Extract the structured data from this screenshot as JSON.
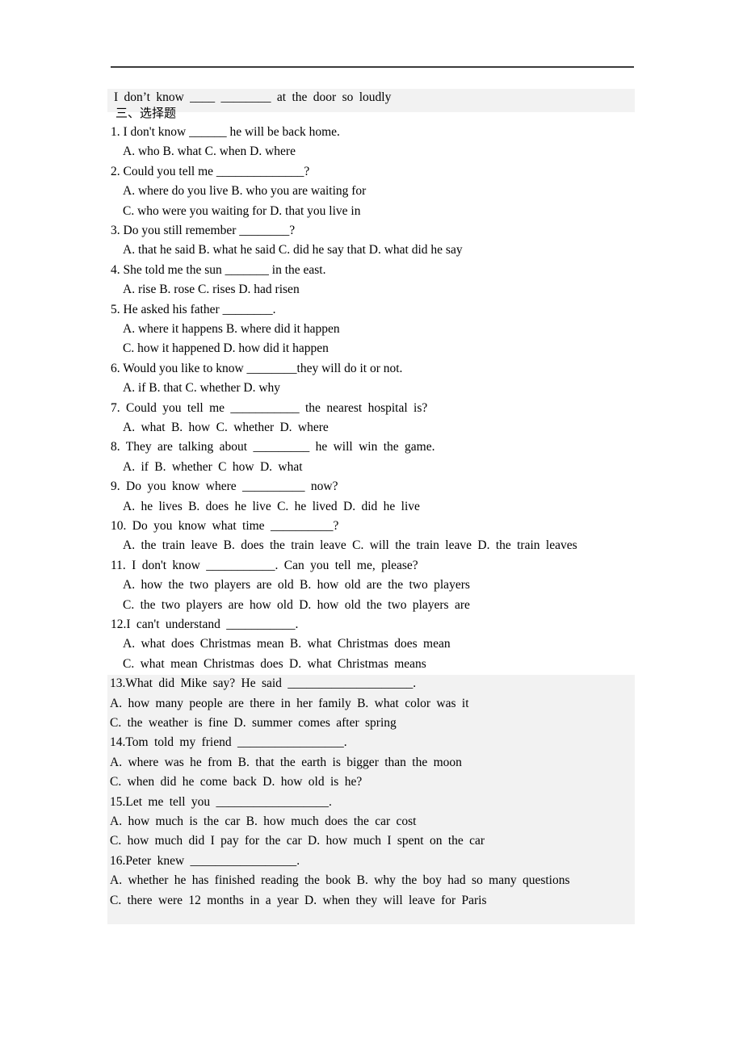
{
  "document": {
    "type": "worksheet",
    "section_heading": "三、选择题",
    "top_shaded_line": "I don’t know ____  ________  at the door so loudly",
    "questions": [
      {
        "number": "1.",
        "stem": "I don't know ______ he will be back home.",
        "option_lines": [
          "A. who    B. what    C. when    D. where"
        ],
        "indented": true,
        "spaced": false
      },
      {
        "number": "2.",
        "stem": "Could you tell me ______________?",
        "option_lines": [
          "A. where do you live            B. who you are waiting for",
          "C. who were you waiting for     D. that you live in"
        ],
        "indented": true,
        "spaced": false
      },
      {
        "number": "3.",
        "stem": "Do you still remember ________?",
        "option_lines": [
          "A. that he said    B. what he said    C. did he say that    D. what did he say"
        ],
        "indented": true,
        "spaced": false
      },
      {
        "number": "4.",
        "stem": "She told me the sun _______ in the east.",
        "option_lines": [
          "A. rise    B. rose    C. rises    D. had risen"
        ],
        "indented": true,
        "spaced": false
      },
      {
        "number": "5.",
        "stem": "He asked his father ________.",
        "option_lines": [
          "A. where it happens     B. where did it happen",
          "C. how it happened     D. how did it happen"
        ],
        "indented": true,
        "spaced": false
      },
      {
        "number": "6.",
        "stem": "Would you like to know ________they will do it or not.",
        "option_lines": [
          "A. if    B. that    C. whether    D. why"
        ],
        "indented": true,
        "spaced": false
      },
      {
        "number": "7.",
        "stem": "Could you tell me ___________ the nearest hospital is?",
        "option_lines": [
          "A. what     B. how     C. whether     D. where"
        ],
        "indented": true,
        "spaced": true
      },
      {
        "number": "8.",
        "stem": "They are talking about _________ he will win the game.",
        "option_lines": [
          "A. if       B. whether      C how      D. what"
        ],
        "indented": true,
        "spaced": true
      },
      {
        "number": "9.",
        "stem": "Do you know where __________ now?",
        "option_lines": [
          "A. he lives    B. does he live    C. he lived    D. did he live"
        ],
        "indented": true,
        "spaced": true
      },
      {
        "number": "10.",
        "stem": "Do you know what time __________?",
        "option_lines": [
          "A. the train leave B. does the train leave C. will the train leave  D. the train leaves"
        ],
        "indented": true,
        "spaced": true
      },
      {
        "number": "11.",
        "stem": "I don't know ___________. Can you tell me, please?",
        "option_lines": [
          "A. how the two players are old    B. how old are the two players",
          "C. the two players are how old    D. how old the two players are"
        ],
        "indented": true,
        "spaced": true
      },
      {
        "number": "12.",
        "stem": "I can't understand ___________.",
        "option_lines": [
          "A. what does Christmas mean    B. what Christmas does mean",
          "C. what mean Christmas does    D. what Christmas means"
        ],
        "indented": true,
        "spaced": true,
        "no_space_after_number": true
      },
      {
        "number": "13.",
        "stem": "What did Mike say? He said ____________________.",
        "option_lines": [
          "A. how many people are there in her family          B. what color was it",
          "C. the weather is fine                        D. summer comes after spring"
        ],
        "indented": false,
        "spaced": true,
        "no_space_after_number": true
      },
      {
        "number": "14.",
        "stem": "Tom told my friend _________________.",
        "option_lines": [
          "A. where was he from          B. that the earth is bigger than the moon",
          "C. when did he come back     D. how old is he?"
        ],
        "indented": false,
        "spaced": true,
        "no_space_after_number": true
      },
      {
        "number": "15.",
        "stem": "Let me tell you __________________.",
        "option_lines": [
          "A. how much is the car                  B. how much does the car cost",
          "C. how much did I pay for the car      D. how much I spent on the car"
        ],
        "indented": false,
        "spaced": true,
        "no_space_after_number": true
      },
      {
        "number": "16.",
        "stem": "Peter knew _________________.",
        "option_lines": [
          "A. whether he has finished reading the book      B. why the boy had so many questions",
          "C. there were 12 months in a year      D. when they will leave for Paris"
        ],
        "indented": false,
        "spaced": true,
        "no_space_after_number": true
      }
    ]
  },
  "style": {
    "shade_color": "#f2f2f2",
    "rule_color": "#3b3b3b",
    "text_color": "#000000"
  }
}
